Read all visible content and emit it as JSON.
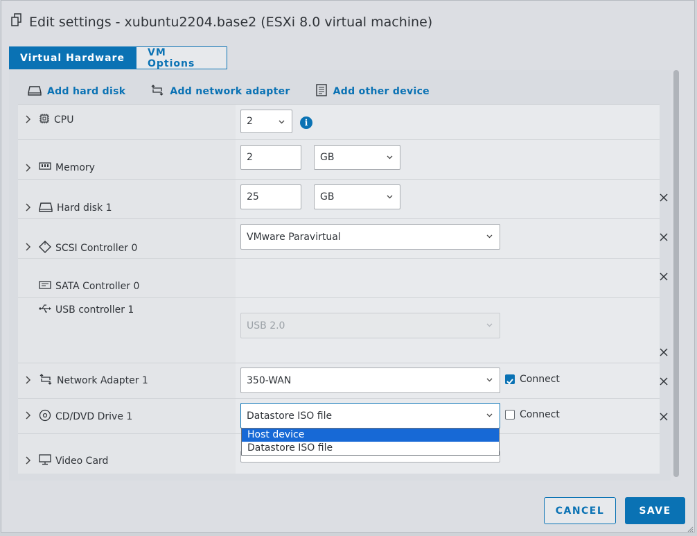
{
  "dialog": {
    "title": "Edit settings - xubuntu2204.base2 (ESXi 8.0 virtual machine)",
    "tabs": [
      {
        "label": "Virtual Hardware",
        "active": true
      },
      {
        "label": "VM Options",
        "active": false
      }
    ]
  },
  "toolbar": {
    "add_hard_disk": "Add hard disk",
    "add_network_adapter": "Add network adapter",
    "add_other_device": "Add other device"
  },
  "devices": {
    "cpu": {
      "label": "CPU",
      "value": "2",
      "info": "i"
    },
    "memory": {
      "label": "Memory",
      "value": "2",
      "unit": "GB"
    },
    "hard_disk": {
      "label": "Hard disk 1",
      "value": "25",
      "unit": "GB"
    },
    "scsi": {
      "label": "SCSI Controller 0",
      "value": "VMware Paravirtual"
    },
    "sata": {
      "label": "SATA Controller 0"
    },
    "usb": {
      "label": "USB controller 1",
      "value": "USB 2.0"
    },
    "network": {
      "label": "Network Adapter 1",
      "value": "350-WAN",
      "connect_label": "Connect",
      "connected": true
    },
    "cddvd": {
      "label": "CD/DVD Drive 1",
      "value": "Datastore ISO file",
      "connect_label": "Connect",
      "connected": false,
      "options": [
        "Host device",
        "Datastore ISO file"
      ],
      "highlighted_option": "Host device"
    },
    "video": {
      "label": "Video Card"
    }
  },
  "footer": {
    "cancel": "CANCEL",
    "save": "SAVE"
  },
  "colors": {
    "accent": "#0a72b4",
    "highlight": "#1769d6"
  }
}
